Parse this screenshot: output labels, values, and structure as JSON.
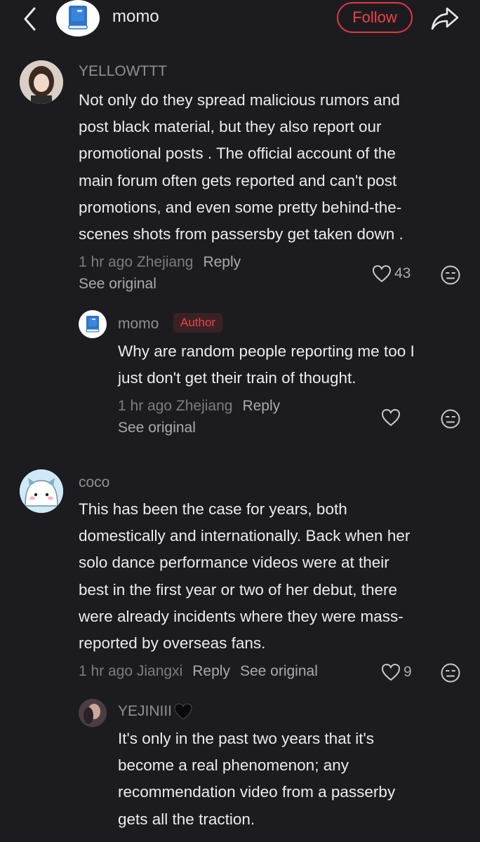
{
  "header": {
    "account_name": "momo",
    "follow_label": "Follow",
    "icons": [
      "chevron-left-icon",
      "book-icon",
      "share-icon"
    ]
  },
  "comments": [
    {
      "user": "YELLOWTTT",
      "text_lines": [
        "Not only do they spread malicious rumors and",
        "post black material, but they also report our",
        "promotional posts . The official account of the",
        "main forum often gets reported and can't post",
        "promotions, and even some pretty behind-the-",
        "scenes shots from passersby get taken down ."
      ],
      "time": "1 hr ago Zhejiang",
      "reply": "Reply",
      "see_original": "See original",
      "likes": "43"
    },
    {
      "user": "momo",
      "badge": "Author",
      "text_lines": [
        "Why are random people reporting me too  I",
        "just don't get their train of thought."
      ],
      "time": "1 hr ago Zhejiang",
      "reply": "Reply",
      "see_original": "See original"
    },
    {
      "user": "coco",
      "text_lines": [
        "This has been the case for years, both",
        "domestically and internationally. Back when her",
        "solo dance performance videos were at their",
        "best in the first year or two of her debut, there",
        "were already incidents where they were mass-",
        "reported by overseas fans."
      ],
      "time": "1 hr ago Jiangxi",
      "reply": "Reply",
      "see_original": "See original",
      "likes": "9"
    },
    {
      "user": "YEJINIII",
      "text_lines": [
        "It's only in the past two years that it's",
        "become a real phenomenon; any",
        "recommendation video from a passerby",
        "gets all the traction."
      ]
    }
  ],
  "colors": {
    "background": "#1c1c20",
    "follow_red": "#e0393f",
    "author_badge": "#e8464c"
  }
}
